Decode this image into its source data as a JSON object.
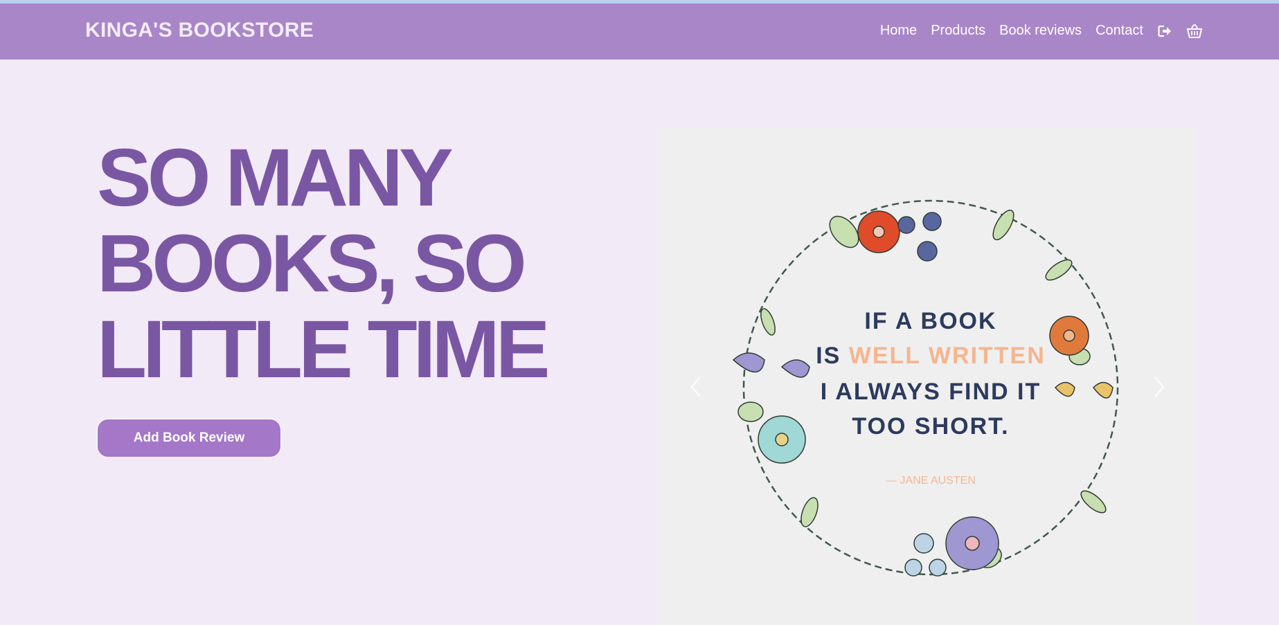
{
  "brand": "KINGA'S BOOKSTORE",
  "nav": {
    "home": "Home",
    "products": "Products",
    "reviews": "Book reviews",
    "contact": "Contact",
    "logout_icon": "sign-out-icon",
    "cart_icon": "basket-icon"
  },
  "hero": {
    "title": "SO MANY BOOKS, SO LITTLE TIME",
    "button": "Add Book Review"
  },
  "carousel": {
    "quote_line1": "IF A BOOK",
    "quote_line2_a": "IS ",
    "quote_line2_b": "WELL WRITTEN",
    "quote_line3": "I ALWAYS FIND IT",
    "quote_line4": "TOO SHORT.",
    "quote_author": "— JANE AUSTEN",
    "prev_icon": "chevron-left-icon",
    "next_icon": "chevron-right-icon"
  },
  "colors": {
    "navbar": "#a986c8",
    "background": "#f2eaf7",
    "heading": "#7a57a3",
    "button": "#a477c8",
    "quote_accent": "#f6b58f"
  }
}
